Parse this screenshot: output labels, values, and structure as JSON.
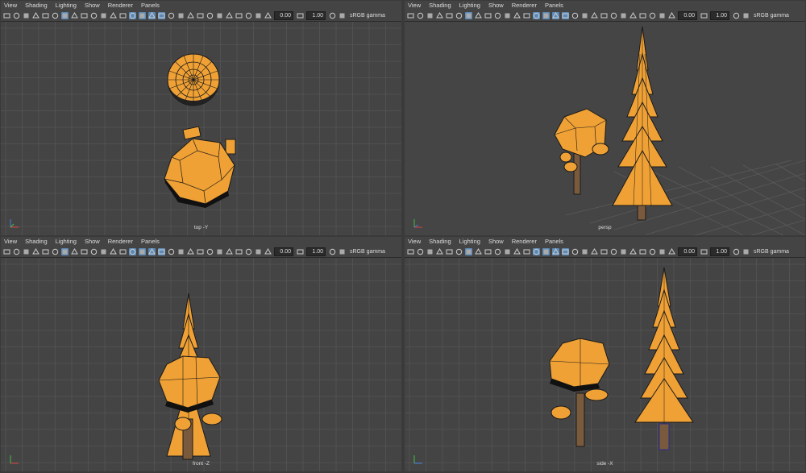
{
  "menu": [
    "View",
    "Shading",
    "Lighting",
    "Show",
    "Renderer",
    "Panels"
  ],
  "toolbar": {
    "field1": "0.00",
    "field2": "1.00",
    "colorspace": "sRGB gamma"
  },
  "panes": [
    {
      "camera": "top -Y"
    },
    {
      "camera": "persp"
    },
    {
      "camera": "front -Z"
    },
    {
      "camera": "side -X"
    }
  ],
  "colors": {
    "orange": "#f0a135",
    "wire": "#1a1a1a",
    "pane": "#444444",
    "grid": "#555555",
    "highlight": "#5c8ab8"
  },
  "icons": [
    "camera-icon",
    "camera-attr-icon",
    "bookmark-icon",
    "image-plane-icon",
    "2d-pan-icon",
    "grease-pencil-icon",
    "grid-icon",
    "film-gate-icon",
    "resolution-gate-icon",
    "gate-mask-icon",
    "field-chart-icon",
    "safe-action-icon",
    "safe-title-icon",
    "wireframe-icon",
    "smooth-shade-icon",
    "default-material-icon",
    "wireframe-on-shaded-icon",
    "textured-icon",
    "use-lights-icon",
    "shadows-icon",
    "screen-ao-icon",
    "motion-blur-icon",
    "multisample-aa-icon",
    "depth-of-field-icon",
    "isolate-icon",
    "xray-icon",
    "xray-joints-icon",
    "xray-components-icon",
    "exposure-icon",
    "gamma-icon",
    "colorspace-icon"
  ]
}
